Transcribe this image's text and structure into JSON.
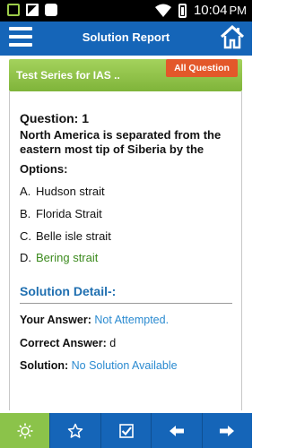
{
  "status_bar": {
    "time": "10:04",
    "ampm": "PM"
  },
  "app_bar": {
    "title": "Solution Report"
  },
  "header": {
    "test_name": "Test Series for IAS ..",
    "all_question_label": "All Question"
  },
  "question": {
    "number_label": "Question: 1",
    "text": "North America is separated from the eastern most tip of Siberia by the",
    "options_label": "Options:",
    "options": [
      {
        "key": "A.",
        "text": "Hudson strait"
      },
      {
        "key": "B.",
        "text": "Florida Strait"
      },
      {
        "key": "C.",
        "text": "Belle isle strait"
      },
      {
        "key": "D.",
        "text": "Bering strait"
      }
    ]
  },
  "solution": {
    "title": "Solution Detail-:",
    "your_answer_label": "Your Answer:",
    "your_answer_value": "Not Attempted.",
    "correct_answer_label": "Correct Answer:",
    "correct_answer_value": "d",
    "solution_label": "Solution:",
    "solution_value": "No Solution Available"
  },
  "colors": {
    "app_bar": "#1565b8",
    "accent_green": "#8bc34a",
    "button_orange": "#e3582a",
    "correct_text": "#3c8b1e",
    "link_blue": "#2a8ad0"
  },
  "bottom_tabs": [
    "lightbulb-icon",
    "star-icon",
    "checkbox-icon",
    "arrow-left-icon",
    "arrow-right-icon"
  ]
}
